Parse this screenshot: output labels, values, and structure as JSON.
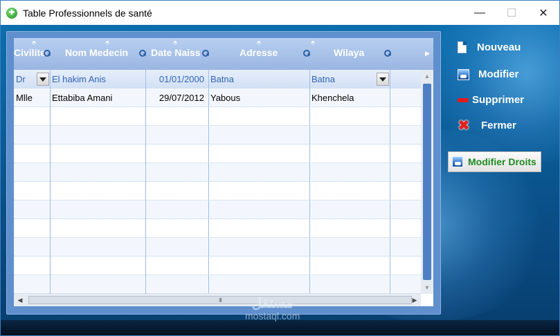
{
  "window": {
    "title": "Table Professionnels de santé",
    "controls": {
      "minimize": "—",
      "maximize": "☐",
      "close": "✕"
    }
  },
  "grid": {
    "columns": [
      {
        "label": "Civilite"
      },
      {
        "label": "Nom Medecin"
      },
      {
        "label": "Date Naiss"
      },
      {
        "label": "Adresse"
      },
      {
        "label": "Wilaya"
      }
    ],
    "rows": [
      {
        "civilite": "Dr",
        "nom": "El hakim Anis",
        "date": "01/01/2000",
        "adresse": "Batna",
        "wilaya": "Batna"
      },
      {
        "civilite": "Mlle",
        "nom": "Ettabiba Amani",
        "date": "29/07/2012",
        "adresse": "Yabous",
        "wilaya": "Khenchela"
      }
    ],
    "scroll": {
      "up": "▲",
      "down": "▼",
      "left": "◀",
      "right": "▶",
      "grip": "III"
    }
  },
  "actions": {
    "nouveau": "Nouveau",
    "modifier": "Modifier",
    "supprimer": "Supprimer",
    "fermer": "Fermer",
    "modifier_droits": "Modifier Droits"
  },
  "watermark": {
    "arabic": "مستقل",
    "latin": "mostaql.com"
  },
  "colors": {
    "accent": "#5f8fcc",
    "header": "#99b6e2",
    "edit_row_text": "#2f63b8",
    "droits_text": "#1f8a1f"
  }
}
